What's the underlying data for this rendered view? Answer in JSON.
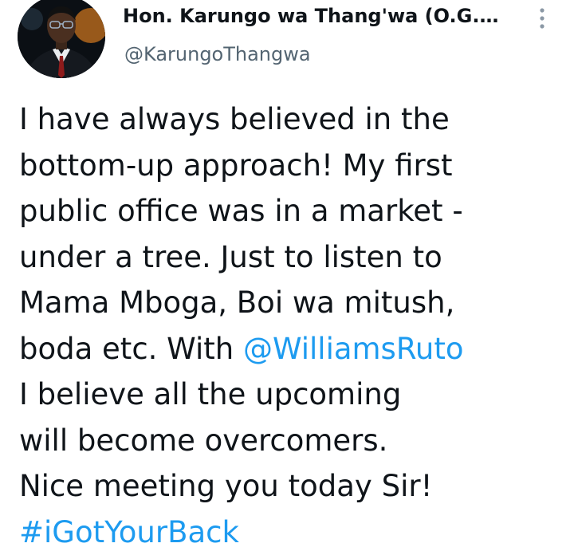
{
  "author": {
    "display_name": "Hon. Karungo wa Thang'wa (O.G.…",
    "handle": "@KarungoThangwa",
    "avatar_icon": "profile-photo"
  },
  "more_icon": "vertical-dots-icon",
  "tweet": {
    "lines": [
      "I have always believed in the",
      "bottom-up approach! My first",
      "public office was in a market -",
      "under a tree. Just to listen to",
      "Mama Mboga, Boi wa mitush,",
      "boda etc. With ",
      "I believe all the upcoming",
      "will become overcomers.",
      "Nice meeting you today Sir!"
    ],
    "mention": "@WilliamsRuto",
    "hashtag": "#iGotYourBack"
  },
  "colors": {
    "text": "#0f1419",
    "secondary_text": "#536471",
    "link": "#1d9bf0"
  }
}
